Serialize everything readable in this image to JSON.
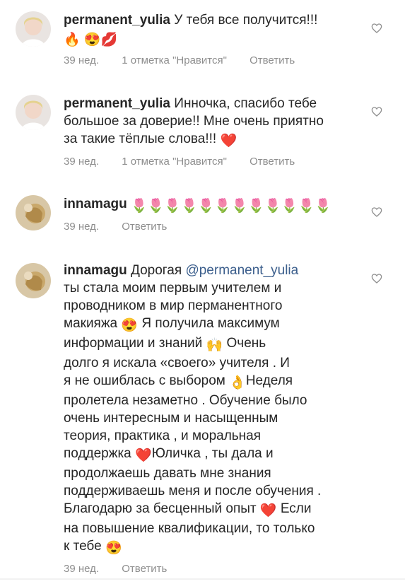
{
  "comments": [
    {
      "username": "permanent_yulia",
      "text": "У тебя все получится!!!",
      "emoji_suffix": "🔥 😍💋",
      "time": "39 нед.",
      "likes": "1 отметка \"Нравится\"",
      "reply": "Ответить"
    },
    {
      "username": "permanent_yulia",
      "text_lines": [
        "Инночка, спасибо тебе",
        "большое за доверие!! Мне очень приятно",
        "за  такие тёплые слова!!!"
      ],
      "emoji_suffix": "❤️",
      "time": "39 нед.",
      "likes": "1 отметка \"Нравится\"",
      "reply": "Ответить"
    },
    {
      "username": "innamagu",
      "emoji_text": "🌷🌷🌷🌷🌷🌷🌷🌷🌷🌷🌷🌷",
      "time": "39 нед.",
      "reply": "Ответить"
    },
    {
      "username": "innamagu",
      "greeting": "Дорогая",
      "mention": "@permanent_yulia",
      "lines": [
        "ты стала моим первым учителем и",
        "проводником в мир перманентного",
        "макияжа",
        "Я получила максимум",
        "информации и знаний",
        "Очень",
        "долго я искала «своего» учителя . И",
        "я не ошиблась с выбором",
        "Неделя",
        "пролетела незаметно . Обучение было",
        "очень интересным и насыщенным",
        "теория,  практика , и моральная",
        "поддержка",
        "Юличка , ты дала и",
        "продолжаешь давать мне знания",
        "поддерживаешь меня и после обучения .",
        "Благодарю за бесценный опыт",
        "Если",
        "на повышение квалификации, то только",
        "к тебе"
      ],
      "time": "39 нед.",
      "reply": "Ответить"
    }
  ],
  "icons": {
    "like": "heart-outline-icon"
  },
  "colors": {
    "text": "#262626",
    "meta": "#8e8e8e",
    "mention": "#3b5e8c"
  }
}
